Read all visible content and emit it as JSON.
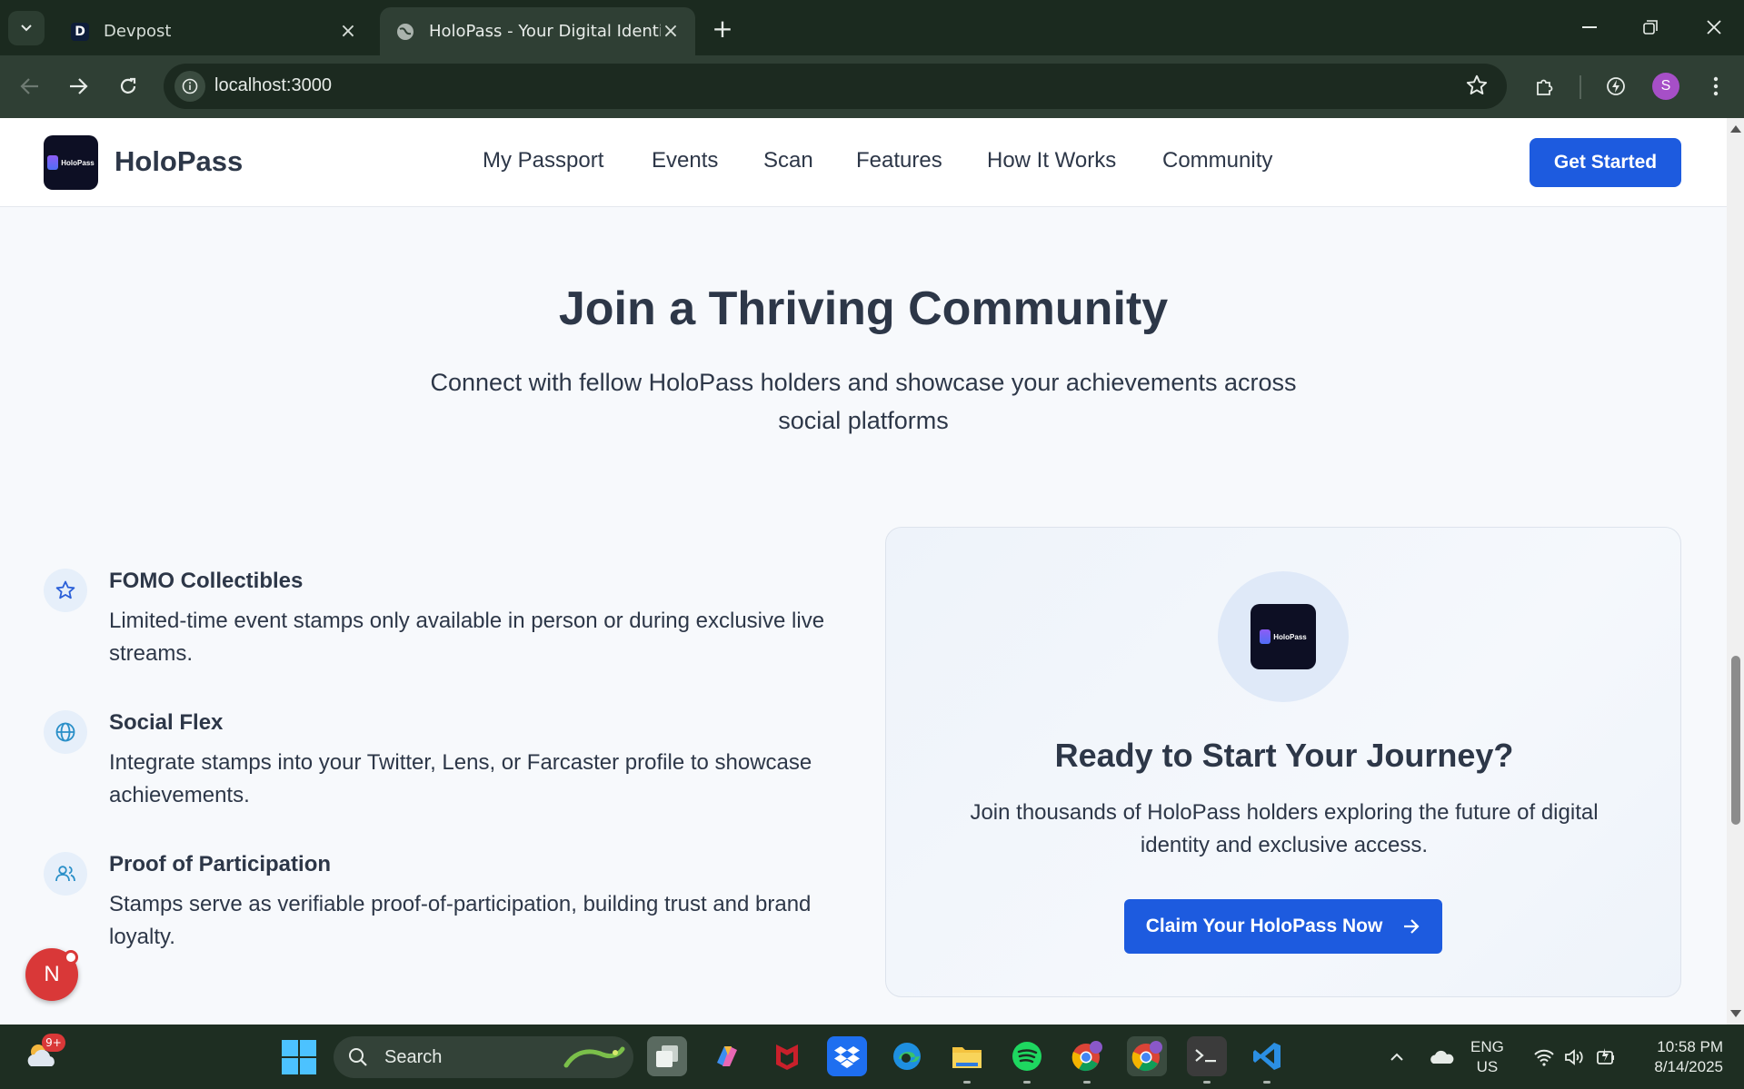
{
  "browser": {
    "tabs": [
      {
        "favicon": "D",
        "title": "Devpost"
      },
      {
        "favicon": "globe-icon",
        "title": "HoloPass - Your Digital Identity"
      }
    ],
    "url": "localhost:3000",
    "profile_initial": "S"
  },
  "site": {
    "logo_text": "HoloPass",
    "brand": "HoloPass",
    "nav": [
      "My Passport",
      "Events",
      "Scan",
      "Features",
      "How It Works",
      "Community"
    ],
    "cta": "Get Started",
    "accent_color": "#1d5bdf"
  },
  "hero": {
    "title": "Join a Thriving Community",
    "subtitle": "Connect with fellow HoloPass holders and showcase your achievements across social platforms"
  },
  "features": [
    {
      "icon": "star-icon",
      "title": "FOMO Collectibles",
      "description": "Limited-time event stamps only available in person or during exclusive live streams."
    },
    {
      "icon": "globe-icon",
      "title": "Social Flex",
      "description": "Integrate stamps into your Twitter, Lens, or Farcaster profile to showcase achievements."
    },
    {
      "icon": "users-icon",
      "title": "Proof of Participation",
      "description": "Stamps serve as verifiable proof-of-participation, building trust and brand loyalty."
    }
  ],
  "card": {
    "logo_text": "HoloPass",
    "title": "Ready to Start Your Journey?",
    "description": "Join thousands of HoloPass holders exploring the future of digital identity and exclusive access.",
    "button": "Claim Your HoloPass Now"
  },
  "notification_avatar": "N",
  "taskbar": {
    "weather_badge": "9+",
    "search_placeholder": "Search",
    "lang_line1": "ENG",
    "lang_line2": "US",
    "time": "10:58 PM",
    "date": "8/14/2025"
  }
}
